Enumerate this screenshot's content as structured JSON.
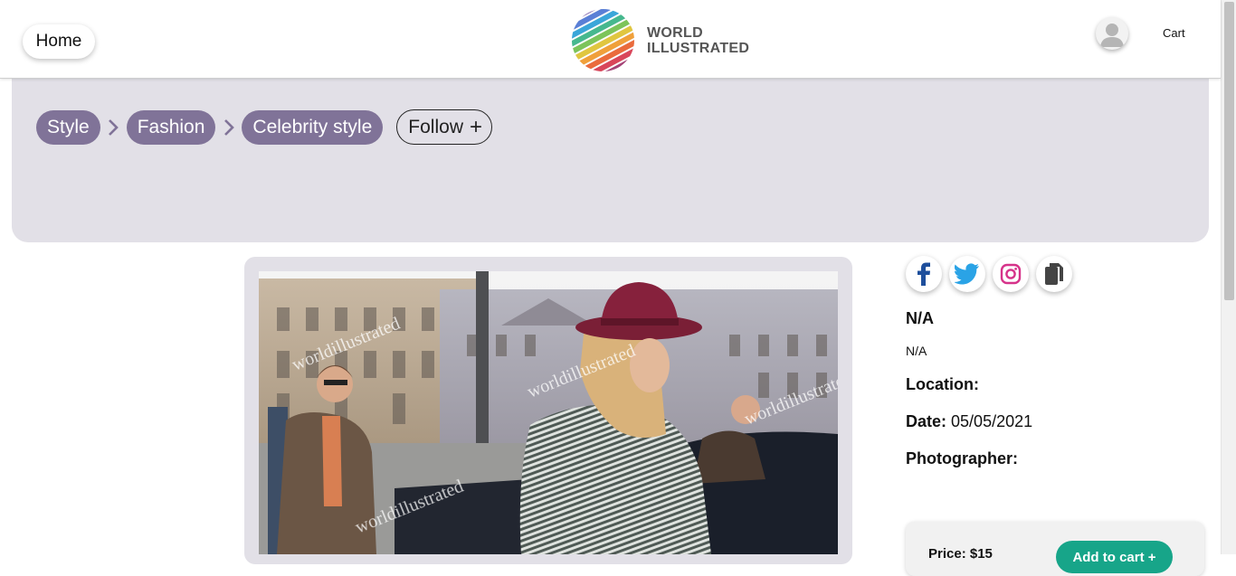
{
  "header": {
    "home_label": "Home",
    "logo_line1": "WORLD",
    "logo_line2": "ILLUSTRATED",
    "cart_label": "Cart"
  },
  "breadcrumbs": [
    {
      "label": "Style"
    },
    {
      "label": "Fashion"
    },
    {
      "label": "Celebrity style"
    }
  ],
  "follow_label": "Follow",
  "follow_icon": "+",
  "photo": {
    "watermarks": [
      "worldillustrated",
      "worldillustrated",
      "worldillustrated",
      "worldillustrated"
    ]
  },
  "social_icons": [
    "facebook-icon",
    "twitter-icon",
    "instagram-icon",
    "copy-icon"
  ],
  "details": {
    "title": "N/A",
    "subtitle": "N/A",
    "location_label": "Location:",
    "location_value": "",
    "date_label": "Date:",
    "date_value": "05/05/2021",
    "photographer_label": "Photographer:",
    "photographer_value": ""
  },
  "purchase": {
    "price_label": "Price: $15",
    "add_to_cart_label": "Add to cart +"
  },
  "colors": {
    "pill": "#807398",
    "banner": "#e2e0e7",
    "add_button": "#17a589",
    "facebook": "#1e4f9c",
    "twitter": "#2aa3e6",
    "instagram": "#d6338a"
  }
}
